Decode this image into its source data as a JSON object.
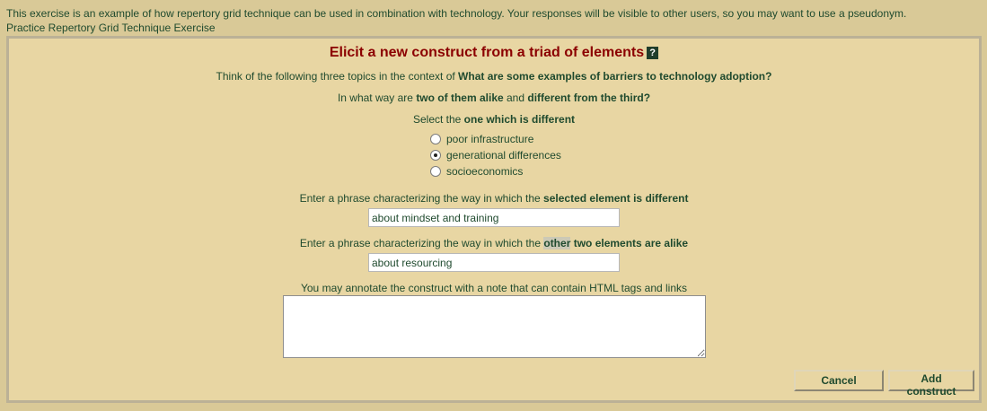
{
  "notice": "This exercise is an example of how repertory grid technique can be used in combination with technology. Your responses will be visible to other users, so you may want to use a pseudonym.",
  "exercise_title": "Practice Repertory Grid Technique Exercise",
  "heading": "Elicit a new construct from a triad of elements",
  "help_glyph": "?",
  "intro": {
    "prefix": "Think of the following three topics in the context of ",
    "context": "What are some examples of barriers to technology adoption?"
  },
  "question": {
    "a": "In what way are ",
    "b": "two of them alike",
    "c": " and ",
    "d": "different from the third?"
  },
  "select": {
    "a": "Select the ",
    "b": "one which is different"
  },
  "elements": [
    {
      "label": "poor infrastructure",
      "checked": false
    },
    {
      "label": "generational differences",
      "checked": true
    },
    {
      "label": "socioeconomics",
      "checked": false
    }
  ],
  "different_prompt": {
    "a": "Enter a phrase characterizing the way in which the ",
    "b": "selected element is different"
  },
  "different_value": "about mindset and training",
  "alike_prompt": {
    "a": "Enter a phrase characterizing the way in which the ",
    "b": "other",
    "c": " ",
    "d": "two elements are alike"
  },
  "alike_value": "about resourcing",
  "note_prompt": "You may annotate the construct with a note that can contain HTML tags and links",
  "note_value": "",
  "buttons": {
    "cancel": "Cancel",
    "add": "Add construct"
  }
}
